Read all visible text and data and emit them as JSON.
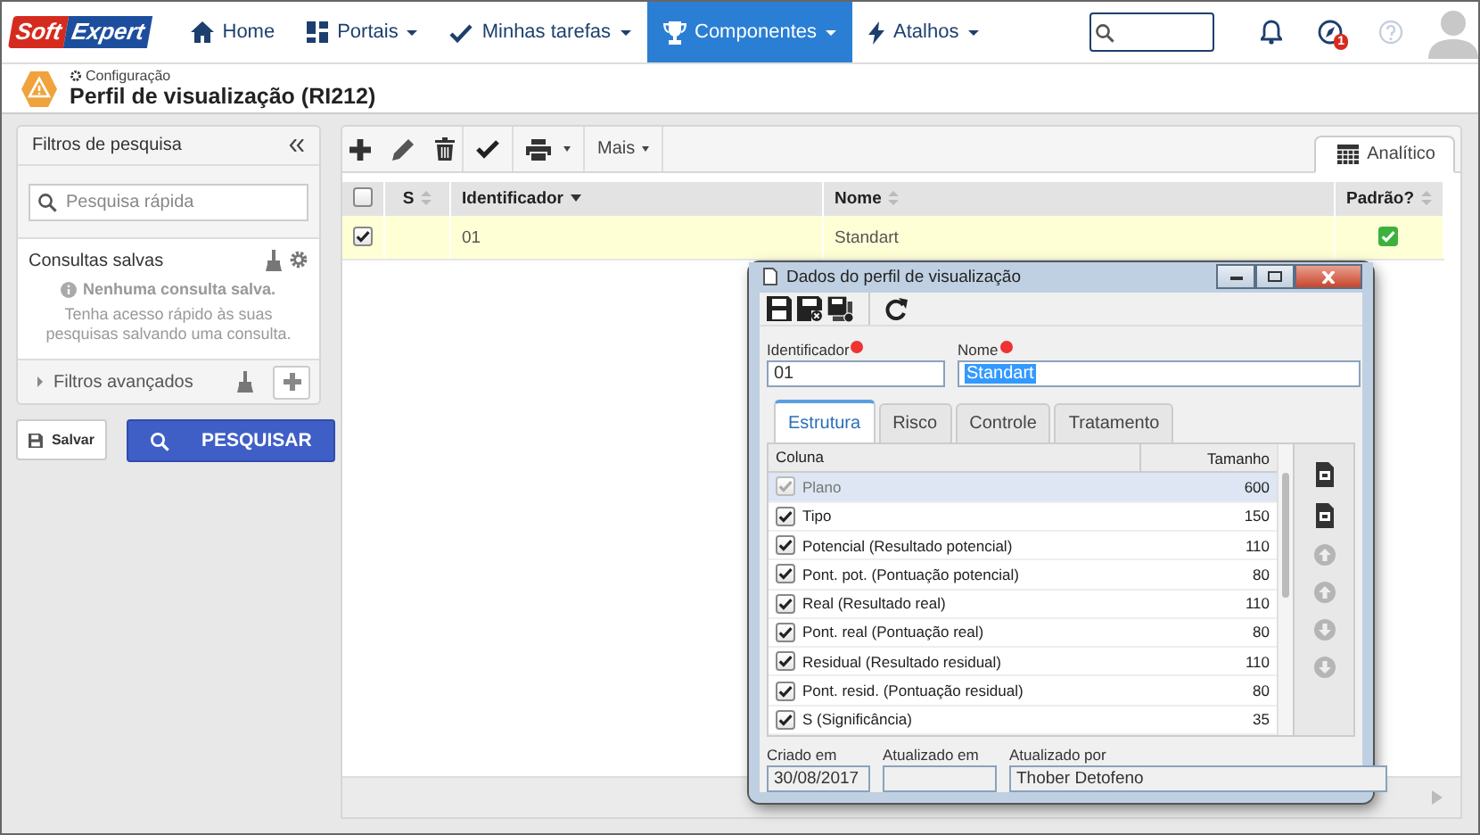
{
  "nav": {
    "brand": {
      "first": "Soft",
      "second": "Expert"
    },
    "items": [
      {
        "label": "Home",
        "dropdown": false,
        "selected": false
      },
      {
        "label": "Portais",
        "dropdown": true,
        "selected": false
      },
      {
        "label": "Minhas tarefas",
        "dropdown": true,
        "selected": false
      },
      {
        "label": "Componentes",
        "dropdown": true,
        "selected": true
      },
      {
        "label": "Atalhos",
        "dropdown": true,
        "selected": false
      }
    ],
    "notification_count": "1"
  },
  "header": {
    "breadcrumb": "Configuração",
    "title": "Perfil de visualização (RI212)"
  },
  "filters": {
    "title": "Filtros de pesquisa",
    "search": {
      "placeholder": "Pesquisa rápida"
    },
    "saved_title": "Consultas salvas",
    "empty_title": "Nenhuma consulta salva.",
    "empty_text": "Tenha acesso rápido às suas pesquisas salvando uma consulta.",
    "advanced": {
      "label": "Filtros avançados",
      "expanded": false
    },
    "save_button": "Salvar",
    "search_button": "PESQUISAR"
  },
  "toolbar": {
    "more": "Mais",
    "view_tab": {
      "label": "Analítico",
      "selected": true
    }
  },
  "table": {
    "select_all": false,
    "columns": [
      {
        "label": "S",
        "sorted": false
      },
      {
        "label": "Identificador",
        "sorted": true
      },
      {
        "label": "Nome",
        "sorted": false
      },
      {
        "label": "Padrão?",
        "sorted": false
      }
    ],
    "rows": [
      {
        "checked": true,
        "identifier": "01",
        "name": "Standart",
        "default": true
      }
    ]
  },
  "dialog": {
    "title": "Dados do perfil de visualização",
    "fields": [
      {
        "label": "Identificador",
        "value": "01",
        "required": true,
        "highlighted": false
      },
      {
        "label": "Nome",
        "value": "Standart",
        "required": true,
        "highlighted": true
      }
    ],
    "tabs": [
      {
        "label": "Estrutura",
        "selected": true
      },
      {
        "label": "Risco",
        "selected": false
      },
      {
        "label": "Controle",
        "selected": false
      },
      {
        "label": "Tratamento",
        "selected": false
      }
    ],
    "columns": [
      "Coluna",
      "Tamanho"
    ],
    "rows": [
      {
        "label": "Plano",
        "size": "600",
        "checked": true,
        "disabled": true,
        "selected": true
      },
      {
        "label": "Tipo",
        "size": "150",
        "checked": true,
        "disabled": false,
        "selected": false
      },
      {
        "label": "Potencial (Resultado potencial)",
        "size": "110",
        "checked": true,
        "disabled": false,
        "selected": false
      },
      {
        "label": "Pont. pot. (Pontuação potencial)",
        "size": "80",
        "checked": true,
        "disabled": false,
        "selected": false
      },
      {
        "label": "Real (Resultado real)",
        "size": "110",
        "checked": true,
        "disabled": false,
        "selected": false
      },
      {
        "label": "Pont. real (Pontuação real)",
        "size": "80",
        "checked": true,
        "disabled": false,
        "selected": false
      },
      {
        "label": "Residual (Resultado residual)",
        "size": "110",
        "checked": true,
        "disabled": false,
        "selected": false
      },
      {
        "label": "Pont. resid. (Pontuação residual)",
        "size": "80",
        "checked": true,
        "disabled": false,
        "selected": false
      },
      {
        "label": "S (Significância)",
        "size": "35",
        "checked": true,
        "disabled": false,
        "selected": false
      }
    ],
    "footer": [
      {
        "label": "Criado em",
        "value": "30/08/2017"
      },
      {
        "label": "Atualizado em"
      },
      {
        "label": "Atualizado por",
        "value": "Thober Detofeno"
      }
    ]
  }
}
